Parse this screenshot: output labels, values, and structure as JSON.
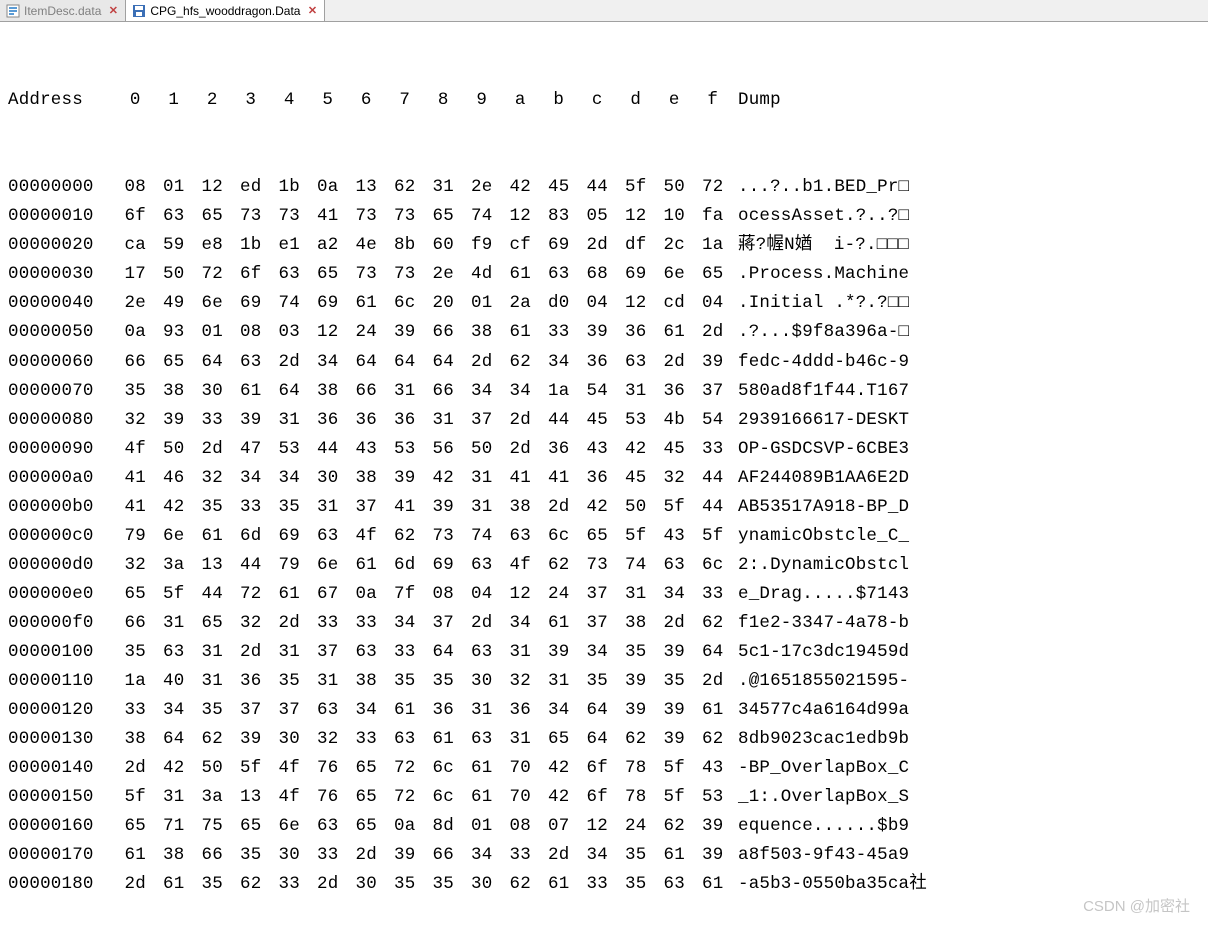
{
  "tabs": [
    {
      "label": "ItemDesc.data",
      "active": false
    },
    {
      "label": "CPG_hfs_wooddragon.Data",
      "active": true
    }
  ],
  "header": {
    "address": "Address",
    "cols": [
      "0",
      "1",
      "2",
      "3",
      "4",
      "5",
      "6",
      "7",
      "8",
      "9",
      "a",
      "b",
      "c",
      "d",
      "e",
      "f"
    ],
    "dump": "Dump"
  },
  "rows": [
    {
      "addr": "00000000",
      "hex": [
        "08",
        "01",
        "12",
        "ed",
        "1b",
        "0a",
        "13",
        "62",
        "31",
        "2e",
        "42",
        "45",
        "44",
        "5f",
        "50",
        "72"
      ],
      "dump": "...?..b1.BED_Pr□"
    },
    {
      "addr": "00000010",
      "hex": [
        "6f",
        "63",
        "65",
        "73",
        "73",
        "41",
        "73",
        "73",
        "65",
        "74",
        "12",
        "83",
        "05",
        "12",
        "10",
        "fa"
      ],
      "dump": "ocessAsset.?..?□"
    },
    {
      "addr": "00000020",
      "hex": [
        "ca",
        "59",
        "e8",
        "1b",
        "e1",
        "a2",
        "4e",
        "8b",
        "60",
        "f9",
        "cf",
        "69",
        "2d",
        "df",
        "2c",
        "1a"
      ],
      "dump": "蔣?幄N媨  i-?.□□□"
    },
    {
      "addr": "00000030",
      "hex": [
        "17",
        "50",
        "72",
        "6f",
        "63",
        "65",
        "73",
        "73",
        "2e",
        "4d",
        "61",
        "63",
        "68",
        "69",
        "6e",
        "65"
      ],
      "dump": ".Process.Machine"
    },
    {
      "addr": "00000040",
      "hex": [
        "2e",
        "49",
        "6e",
        "69",
        "74",
        "69",
        "61",
        "6c",
        "20",
        "01",
        "2a",
        "d0",
        "04",
        "12",
        "cd",
        "04"
      ],
      "dump": ".Initial .*?.?□□"
    },
    {
      "addr": "00000050",
      "hex": [
        "0a",
        "93",
        "01",
        "08",
        "03",
        "12",
        "24",
        "39",
        "66",
        "38",
        "61",
        "33",
        "39",
        "36",
        "61",
        "2d"
      ],
      "dump": ".?...$9f8a396a-□"
    },
    {
      "addr": "00000060",
      "hex": [
        "66",
        "65",
        "64",
        "63",
        "2d",
        "34",
        "64",
        "64",
        "64",
        "2d",
        "62",
        "34",
        "36",
        "63",
        "2d",
        "39"
      ],
      "dump": "fedc-4ddd-b46c-9"
    },
    {
      "addr": "00000070",
      "hex": [
        "35",
        "38",
        "30",
        "61",
        "64",
        "38",
        "66",
        "31",
        "66",
        "34",
        "34",
        "1a",
        "54",
        "31",
        "36",
        "37"
      ],
      "dump": "580ad8f1f44.T167"
    },
    {
      "addr": "00000080",
      "hex": [
        "32",
        "39",
        "33",
        "39",
        "31",
        "36",
        "36",
        "36",
        "31",
        "37",
        "2d",
        "44",
        "45",
        "53",
        "4b",
        "54"
      ],
      "dump": "2939166617-DESKT"
    },
    {
      "addr": "00000090",
      "hex": [
        "4f",
        "50",
        "2d",
        "47",
        "53",
        "44",
        "43",
        "53",
        "56",
        "50",
        "2d",
        "36",
        "43",
        "42",
        "45",
        "33"
      ],
      "dump": "OP-GSDCSVP-6CBE3"
    },
    {
      "addr": "000000a0",
      "hex": [
        "41",
        "46",
        "32",
        "34",
        "34",
        "30",
        "38",
        "39",
        "42",
        "31",
        "41",
        "41",
        "36",
        "45",
        "32",
        "44"
      ],
      "dump": "AF244089B1AA6E2D"
    },
    {
      "addr": "000000b0",
      "hex": [
        "41",
        "42",
        "35",
        "33",
        "35",
        "31",
        "37",
        "41",
        "39",
        "31",
        "38",
        "2d",
        "42",
        "50",
        "5f",
        "44"
      ],
      "dump": "AB53517A918-BP_D"
    },
    {
      "addr": "000000c0",
      "hex": [
        "79",
        "6e",
        "61",
        "6d",
        "69",
        "63",
        "4f",
        "62",
        "73",
        "74",
        "63",
        "6c",
        "65",
        "5f",
        "43",
        "5f"
      ],
      "dump": "ynamicObstcle_C_"
    },
    {
      "addr": "000000d0",
      "hex": [
        "32",
        "3a",
        "13",
        "44",
        "79",
        "6e",
        "61",
        "6d",
        "69",
        "63",
        "4f",
        "62",
        "73",
        "74",
        "63",
        "6c"
      ],
      "dump": "2:.DynamicObstcl"
    },
    {
      "addr": "000000e0",
      "hex": [
        "65",
        "5f",
        "44",
        "72",
        "61",
        "67",
        "0a",
        "7f",
        "08",
        "04",
        "12",
        "24",
        "37",
        "31",
        "34",
        "33"
      ],
      "dump": "e_Drag.....$7143"
    },
    {
      "addr": "000000f0",
      "hex": [
        "66",
        "31",
        "65",
        "32",
        "2d",
        "33",
        "33",
        "34",
        "37",
        "2d",
        "34",
        "61",
        "37",
        "38",
        "2d",
        "62"
      ],
      "dump": "f1e2-3347-4a78-b"
    },
    {
      "addr": "00000100",
      "hex": [
        "35",
        "63",
        "31",
        "2d",
        "31",
        "37",
        "63",
        "33",
        "64",
        "63",
        "31",
        "39",
        "34",
        "35",
        "39",
        "64"
      ],
      "dump": "5c1-17c3dc19459d"
    },
    {
      "addr": "00000110",
      "hex": [
        "1a",
        "40",
        "31",
        "36",
        "35",
        "31",
        "38",
        "35",
        "35",
        "30",
        "32",
        "31",
        "35",
        "39",
        "35",
        "2d"
      ],
      "dump": ".@1651855021595-"
    },
    {
      "addr": "00000120",
      "hex": [
        "33",
        "34",
        "35",
        "37",
        "37",
        "63",
        "34",
        "61",
        "36",
        "31",
        "36",
        "34",
        "64",
        "39",
        "39",
        "61"
      ],
      "dump": "34577c4a6164d99a"
    },
    {
      "addr": "00000130",
      "hex": [
        "38",
        "64",
        "62",
        "39",
        "30",
        "32",
        "33",
        "63",
        "61",
        "63",
        "31",
        "65",
        "64",
        "62",
        "39",
        "62"
      ],
      "dump": "8db9023cac1edb9b"
    },
    {
      "addr": "00000140",
      "hex": [
        "2d",
        "42",
        "50",
        "5f",
        "4f",
        "76",
        "65",
        "72",
        "6c",
        "61",
        "70",
        "42",
        "6f",
        "78",
        "5f",
        "43"
      ],
      "dump": "-BP_OverlapBox_C"
    },
    {
      "addr": "00000150",
      "hex": [
        "5f",
        "31",
        "3a",
        "13",
        "4f",
        "76",
        "65",
        "72",
        "6c",
        "61",
        "70",
        "42",
        "6f",
        "78",
        "5f",
        "53"
      ],
      "dump": "_1:.OverlapBox_S"
    },
    {
      "addr": "00000160",
      "hex": [
        "65",
        "71",
        "75",
        "65",
        "6e",
        "63",
        "65",
        "0a",
        "8d",
        "01",
        "08",
        "07",
        "12",
        "24",
        "62",
        "39"
      ],
      "dump": "equence......$b9"
    },
    {
      "addr": "00000170",
      "hex": [
        "61",
        "38",
        "66",
        "35",
        "30",
        "33",
        "2d",
        "39",
        "66",
        "34",
        "33",
        "2d",
        "34",
        "35",
        "61",
        "39"
      ],
      "dump": "a8f503-9f43-45a9"
    },
    {
      "addr": "00000180",
      "hex": [
        "2d",
        "61",
        "35",
        "62",
        "33",
        "2d",
        "30",
        "35",
        "35",
        "30",
        "62",
        "61",
        "33",
        "35",
        "63",
        "61"
      ],
      "dump": "-a5b3-0550ba35ca社"
    }
  ],
  "watermark": "CSDN @加密社"
}
